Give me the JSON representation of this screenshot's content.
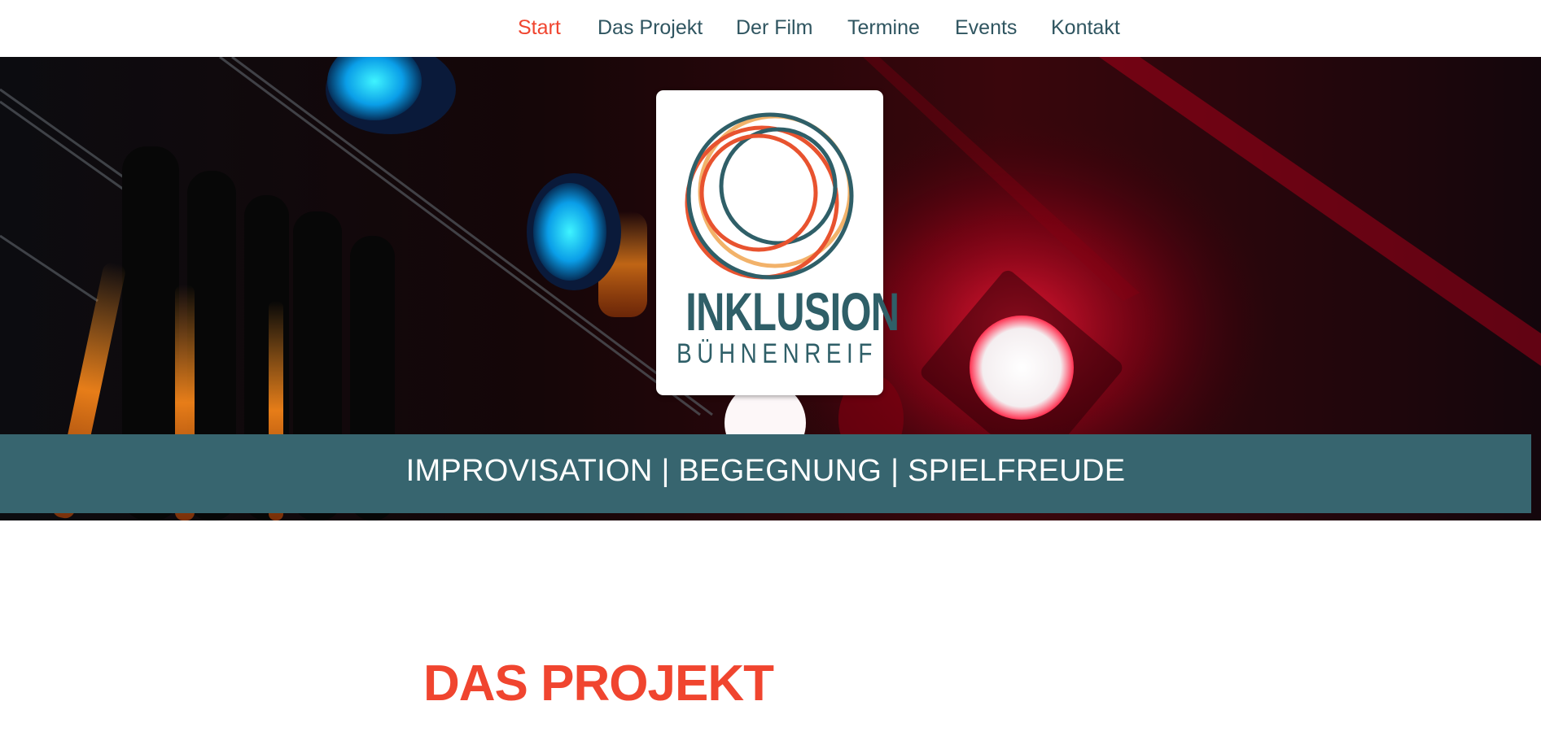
{
  "nav": {
    "items": [
      {
        "label": "Start",
        "active": true
      },
      {
        "label": "Das Projekt",
        "active": false
      },
      {
        "label": "Der Film",
        "active": false
      },
      {
        "label": "Termine",
        "active": false
      },
      {
        "label": "Events",
        "active": false
      },
      {
        "label": "Kontakt",
        "active": false
      }
    ]
  },
  "hero": {
    "logo": {
      "title": "INKLUSION",
      "subtitle": "BÜHNENREIF"
    },
    "tagline": "IMPROVISATION | BEGEGNUNG | SPIELFREUDE"
  },
  "section": {
    "heading": "DAS PROJEKT"
  },
  "colors": {
    "accent": "#f0452f",
    "nav_text": "#2f5560",
    "band": "#37656f",
    "logo_teal": "#2f5f68",
    "ring_orange": "#e8532f",
    "ring_peach": "#f2b26a"
  }
}
